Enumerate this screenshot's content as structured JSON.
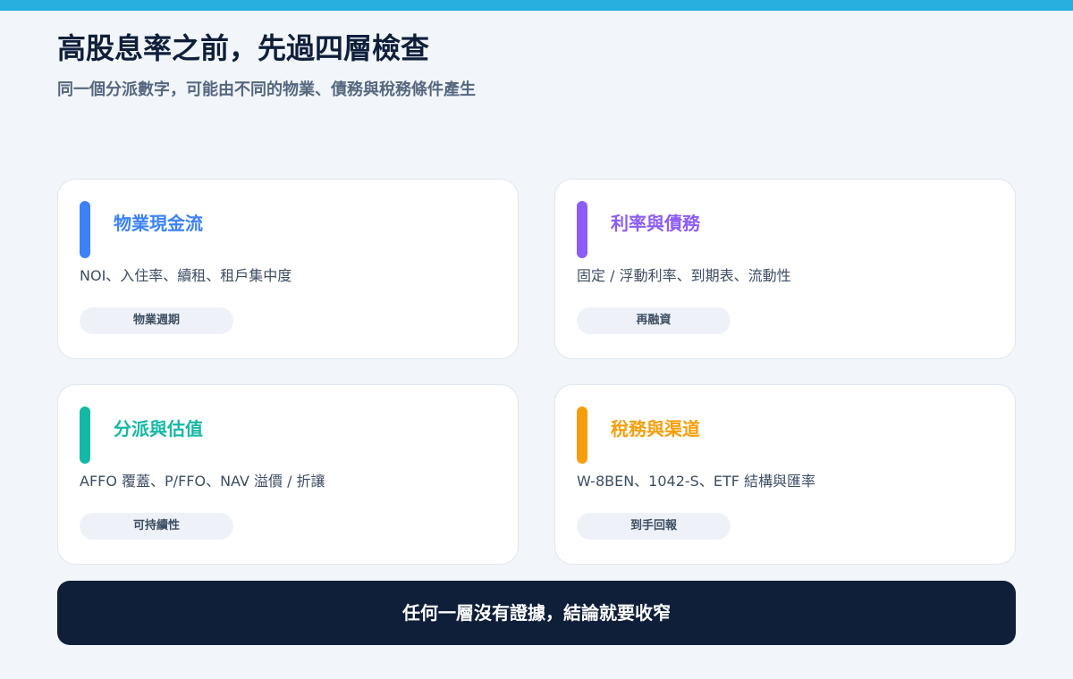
{
  "header": {
    "title": "高股息率之前，先過四層檢查",
    "subtitle": "同一個分派數字，可能由不同的物業、債務與稅務條件產生"
  },
  "colors": {
    "top_bar": "#29aee0",
    "background": "#f2f6fb",
    "blue": "#3b82f6",
    "purple": "#8b5cf6",
    "teal": "#14b8a6",
    "amber": "#f59e0b",
    "navy": "#0f1f3a"
  },
  "cards": [
    {
      "title": "物業現金流",
      "description": "NOI、入住率、續租、租戶集中度",
      "tag": "物業週期",
      "accent": "#3b82f6"
    },
    {
      "title": "利率與債務",
      "description": "固定 / 浮動利率、到期表、流動性",
      "tag": "再融資",
      "accent": "#8b5cf6"
    },
    {
      "title": "分派與估值",
      "description": "AFFO 覆蓋、P/FFO、NAV 溢價 / 折讓",
      "tag": "可持續性",
      "accent": "#14b8a6"
    },
    {
      "title": "稅務與渠道",
      "description": "W-8BEN、1042-S、ETF 結構與匯率",
      "tag": "到手回報",
      "accent": "#f59e0b"
    }
  ],
  "footer": {
    "banner_text": "任何一層沒有證據，結論就要收窄"
  }
}
